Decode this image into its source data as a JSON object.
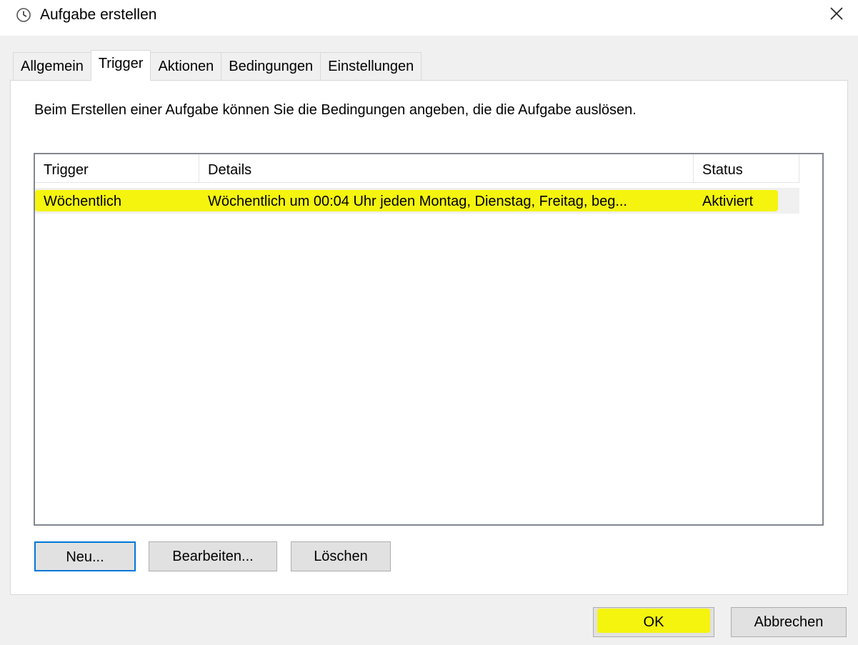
{
  "window": {
    "title": "Aufgabe erstellen",
    "close_symbol": "✕"
  },
  "tabs": [
    {
      "label": "Allgemein",
      "active": false
    },
    {
      "label": "Trigger",
      "active": true
    },
    {
      "label": "Aktionen",
      "active": false
    },
    {
      "label": "Bedingungen",
      "active": false
    },
    {
      "label": "Einstellungen",
      "active": false
    }
  ],
  "panel": {
    "description": "Beim Erstellen einer Aufgabe können Sie die Bedingungen angeben, die die Aufgabe auslösen."
  },
  "table": {
    "columns": [
      "Trigger",
      "Details",
      "Status"
    ],
    "rows": [
      {
        "trigger": "Wöchentlich",
        "details": "Wöchentlich um 00:04 Uhr jeden Montag, Dienstag, Freitag, beg...",
        "status": "Aktiviert"
      }
    ]
  },
  "buttons": {
    "new": "Neu...",
    "edit": "Bearbeiten...",
    "delete": "Löschen",
    "ok": "OK",
    "cancel": "Abbrechen"
  },
  "colors": {
    "highlight": "#f4f40f",
    "focus_border": "#0078d7"
  },
  "icons": {
    "app": "clock-icon",
    "close": "close-icon"
  }
}
